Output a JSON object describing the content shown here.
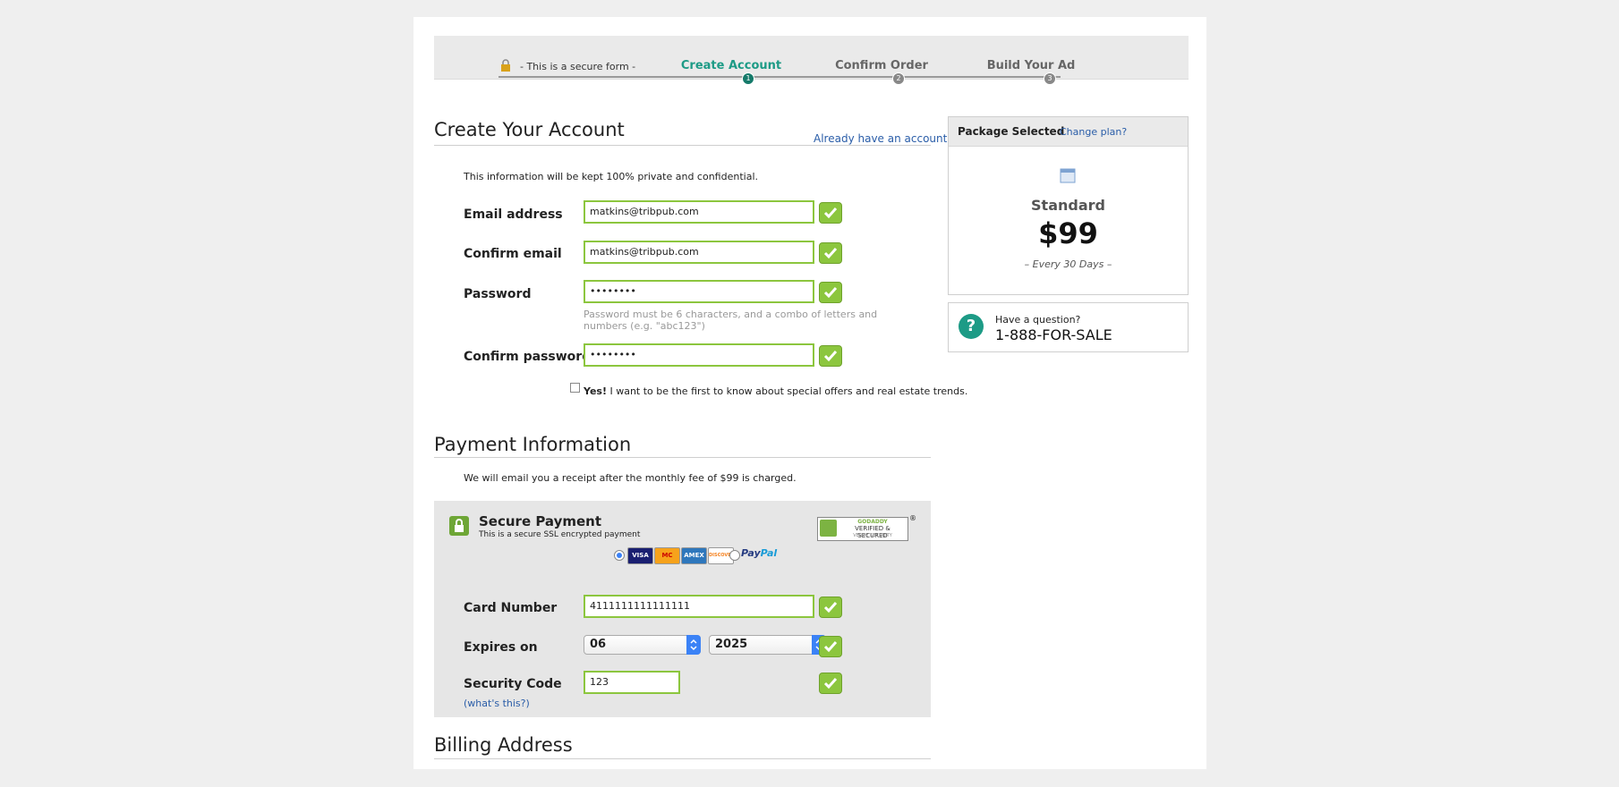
{
  "progress": {
    "secure_text": "- This is a secure form -",
    "steps": [
      {
        "label": "Create Account",
        "number": "1"
      },
      {
        "label": "Confirm Order",
        "number": "2"
      },
      {
        "label": "Build Your Ad",
        "number": "3"
      }
    ]
  },
  "account": {
    "title": "Create Your Account",
    "login_link": "Already have an account?",
    "privacy_note": "This information will be kept 100% private and confidential.",
    "email_label": "Email address",
    "email_value": "matkins@tribpub.com",
    "confirm_email_label": "Confirm email",
    "confirm_email_value": "matkins@tribpub.com",
    "password_label": "Password",
    "password_value": "••••••••",
    "password_hint": "Password must be 6 characters, and a combo of letters and numbers (e.g. \"abc123\")",
    "confirm_password_label": "Confirm password",
    "confirm_password_value": "••••••••",
    "optin_bold": "Yes!",
    "optin_text": " I want to be the first to know about special offers and real estate trends."
  },
  "payment": {
    "title": "Payment Information",
    "receipt_note": "We will email you a receipt after the monthly fee of $99 is charged.",
    "secure_title": "Secure Payment",
    "secure_subtitle": "This is a secure SSL encrypted payment",
    "seal": {
      "brand": "GODADDY",
      "main": "VERIFIED & SECURED",
      "sub": "VERIFY SECURITY",
      "mark": "®"
    },
    "cards": [
      "VISA",
      "MC",
      "AMEX",
      "DISCOVER"
    ],
    "paypal_a": "Pay",
    "paypal_b": "Pal",
    "card_number_label": "Card Number",
    "card_number_value": "4111111111111111",
    "expires_label": "Expires on",
    "expires_month": "06",
    "expires_year": "2025",
    "security_label": "Security Code",
    "security_value": "123",
    "whats_this": "(what's this?)"
  },
  "billing": {
    "title": "Billing Address"
  },
  "package": {
    "header": "Package Selected",
    "change_link": "Change plan?",
    "name": "Standard",
    "price": "$99",
    "period": "– Every 30 Days –"
  },
  "help": {
    "question": "Have a question?",
    "phone": "1-888-FOR-SALE"
  },
  "colors": {
    "accent": "#1d9b86",
    "valid_green": "#8cc63e",
    "link": "#2a5da8"
  }
}
